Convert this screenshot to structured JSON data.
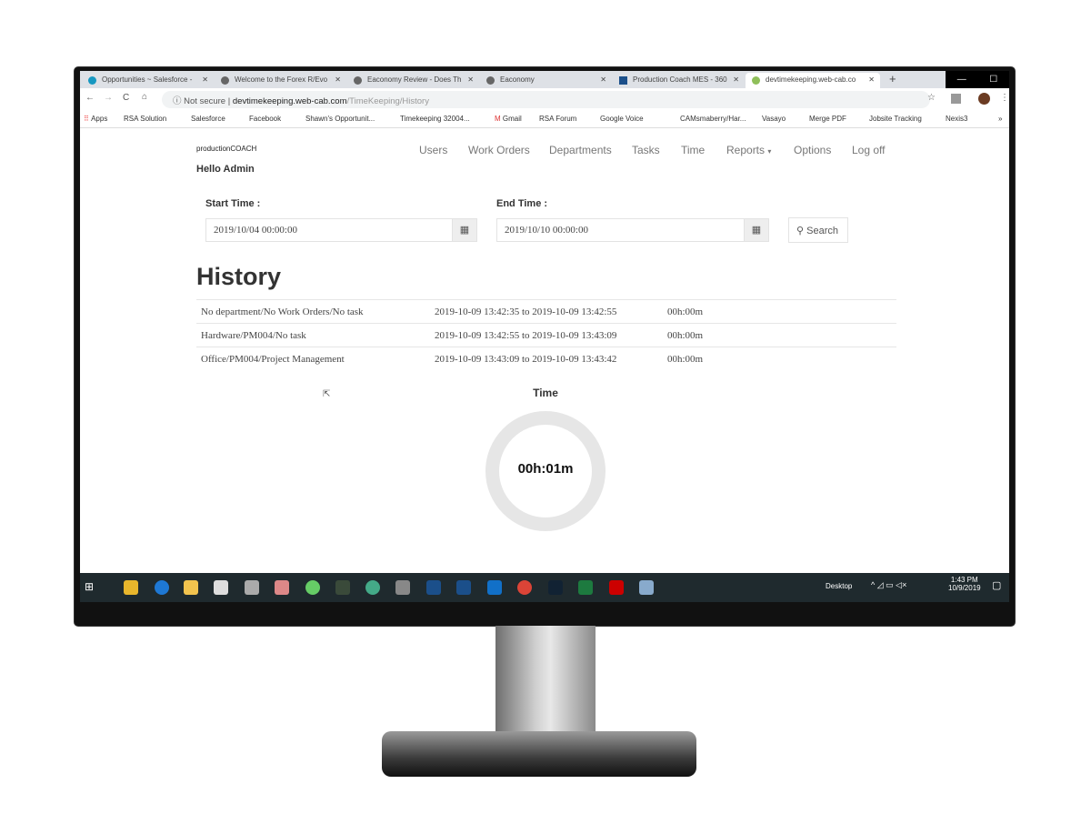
{
  "browser": {
    "tabs": [
      {
        "title": "Opportunities ~ Salesforce -",
        "icon": "salesforce-icon"
      },
      {
        "title": "Welcome to the Forex R/Evo",
        "icon": "globe-icon"
      },
      {
        "title": "Eaconomy Review - Does Th",
        "icon": "globe-icon"
      },
      {
        "title": "Eaconomy",
        "icon": "globe-icon"
      },
      {
        "title": "Production Coach MES - 360",
        "icon": "rsa-icon"
      },
      {
        "title": "devtimekeeping.web-cab.co",
        "icon": "timekeeping-icon",
        "active": true
      }
    ],
    "security": "Not secure",
    "url_host": "devtimekeeping.web-cab.com",
    "url_path": "/TimeKeeping/History",
    "bookmarks": [
      "Apps",
      "RSA Solution",
      "Salesforce",
      "Facebook",
      "Shawn's Opportunit...",
      "Timekeeping 32004...",
      "Gmail",
      "RSA Forum",
      "Google Voice",
      "CAMsmaberry/Har...",
      "Vasayo",
      "Merge PDF",
      "Jobsite Tracking",
      "Nexis3"
    ]
  },
  "app": {
    "logo": "productionCOACH",
    "greeting": "Hello Admin",
    "nav": [
      "Users",
      "Work Orders",
      "Departments",
      "Tasks",
      "Time",
      "Reports",
      "Options",
      "Log off"
    ],
    "start_label": "Start Time :",
    "start_value": "2019/10/04 00:00:00",
    "end_label": "End Time :",
    "end_value": "2019/10/10 00:00:00",
    "search_label": "Search",
    "title": "History",
    "rows": [
      {
        "path": "No department/No Work Orders/No task",
        "range": "2019-10-09 13:42:35 to 2019-10-09 13:42:55",
        "duration": "00h:00m"
      },
      {
        "path": "Hardware/PM004/No task",
        "range": "2019-10-09 13:42:55 to 2019-10-09 13:43:09",
        "duration": "00h:00m"
      },
      {
        "path": "Office/PM004/Project Management",
        "range": "2019-10-09 13:43:09 to 2019-10-09 13:43:42",
        "duration": "00h:00m"
      }
    ],
    "chart_title": "Time",
    "chart_total": "00h:01m"
  },
  "taskbar": {
    "desktop": "Desktop",
    "time": "1:43 PM",
    "date": "10/9/2019"
  },
  "colors": {
    "ring": "#e6e6e6",
    "taskbar": "#1f2a2e"
  }
}
